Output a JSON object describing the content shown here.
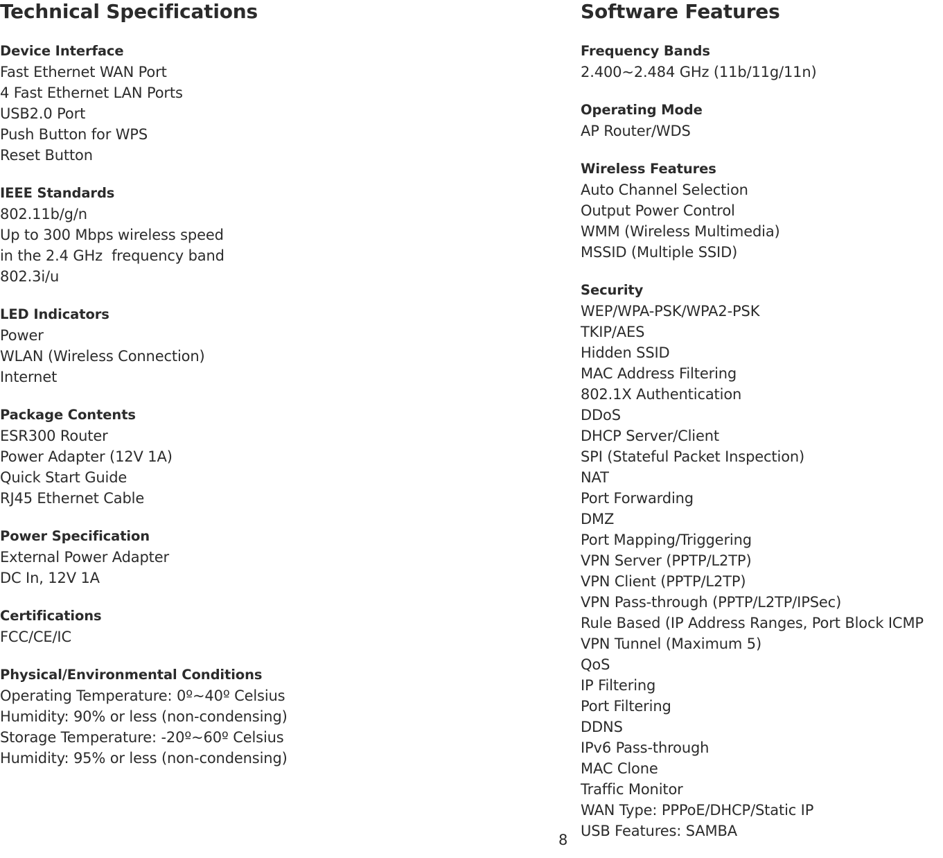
{
  "page": {
    "number": "8",
    "background": "#ffffff",
    "text_color": "#2b2b2b"
  },
  "columns": {
    "left": {
      "title": "Technical Specifications",
      "sections": [
        {
          "heading": "Device Interface",
          "lines": [
            "Fast Ethernet WAN Port",
            "4 Fast Ethernet LAN Ports",
            "USB2.0 Port",
            "Push Button for WPS",
            "Reset Button"
          ]
        },
        {
          "heading": "IEEE Standards",
          "lines": [
            "802.11b/g/n",
            "Up to 300 Mbps wireless speed",
            "in the 2.4 GHz  frequency band",
            "802.3i/u"
          ]
        },
        {
          "heading": "LED Indicators",
          "lines": [
            "Power",
            "WLAN (Wireless Connection)",
            "Internet"
          ]
        },
        {
          "heading": "Package Contents",
          "lines": [
            "ESR300 Router",
            "Power Adapter (12V 1A)",
            "Quick Start Guide",
            "RJ45 Ethernet Cable"
          ]
        },
        {
          "heading": "Power Specification",
          "lines": [
            "External Power Adapter",
            "DC In, 12V 1A"
          ]
        },
        {
          "heading": "Certifications",
          "lines": [
            "FCC/CE/IC"
          ]
        },
        {
          "heading": "Physical/Environmental Conditions",
          "lines": [
            "Operating Temperature: 0º~40º Celsius",
            "Humidity: 90% or less (non-condensing)",
            "Storage Temperature: -20º~60º Celsius",
            "Humidity: 95% or less (non-condensing)"
          ]
        }
      ]
    },
    "right": {
      "title": "Software Features",
      "sections": [
        {
          "heading": "Frequency Bands",
          "lines": [
            "2.400~2.484 GHz (11b/11g/11n)"
          ]
        },
        {
          "heading": "Operating Mode",
          "lines": [
            "AP Router/WDS"
          ]
        },
        {
          "heading": "Wireless Features",
          "lines": [
            "Auto Channel Selection",
            "Output Power Control",
            "WMM (Wireless Multimedia)",
            "MSSID (Multiple SSID)"
          ]
        },
        {
          "heading": "Security",
          "lines": [
            "WEP/WPA-PSK/WPA2-PSK",
            "TKIP/AES",
            "Hidden SSID",
            "MAC Address Filtering",
            "802.1X Authentication",
            "DDoS",
            "DHCP Server/Client",
            "SPI (Stateful Packet Inspection)",
            "NAT",
            "Port Forwarding",
            "DMZ",
            "Port Mapping/Triggering",
            "VPN Server (PPTP/L2TP)",
            "VPN Client (PPTP/L2TP)",
            "VPN Pass-through (PPTP/L2TP/IPSec)",
            "Rule Based (IP Address Ranges, Port Block ICMP",
            "VPN Tunnel (Maximum 5)",
            "QoS",
            "IP Filtering",
            "Port Filtering",
            "DDNS",
            "IPv6 Pass-through",
            "MAC Clone",
            "Traffic Monitor",
            "WAN Type: PPPoE/DHCP/Static IP",
            "USB Features: SAMBA"
          ]
        }
      ]
    }
  }
}
